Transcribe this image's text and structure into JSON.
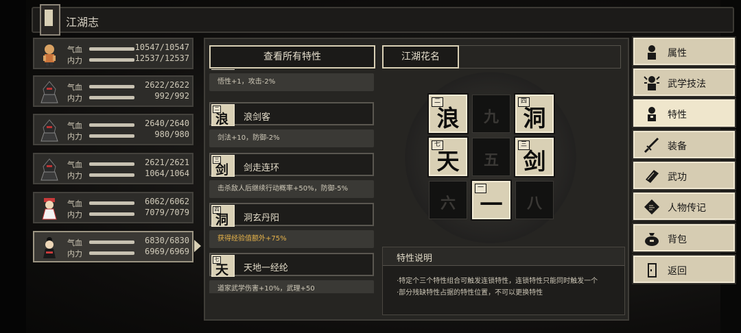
{
  "window": {
    "title": "江湖志"
  },
  "characters": [
    {
      "hp_label": "气血",
      "mp_label": "内力",
      "hp": "10547/10547",
      "mp": "12537/12537"
    },
    {
      "hp_label": "气血",
      "mp_label": "内力",
      "hp": "2622/2622",
      "mp": "992/992"
    },
    {
      "hp_label": "气血",
      "mp_label": "内力",
      "hp": "2640/2640",
      "mp": "980/980"
    },
    {
      "hp_label": "气血",
      "mp_label": "内力",
      "hp": "2621/2621",
      "mp": "1064/1064"
    },
    {
      "hp_label": "气血",
      "mp_label": "内力",
      "hp": "6062/6062",
      "mp": "7079/7079"
    },
    {
      "hp_label": "气血",
      "mp_label": "内力",
      "hp": "6830/6830",
      "mp": "6969/6969"
    }
  ],
  "traits_panel": {
    "view_all_label": "查看所有特性",
    "items": [
      {
        "char": "",
        "num": "",
        "name": "",
        "desc": "悟性+1，攻击-2%"
      },
      {
        "char": "浪",
        "num": "二",
        "name": "浪剑客",
        "desc": "剑法+10，防御-2%"
      },
      {
        "char": "剑",
        "num": "三",
        "name": "剑走连环",
        "desc": "击杀敌人后继续行动概率+50%，防御-5%"
      },
      {
        "char": "洞",
        "num": "四",
        "name": "洞玄丹阳",
        "desc": "获得经验值额外+75%"
      },
      {
        "char": "天",
        "num": "七",
        "name": "天地一经纶",
        "desc": "道家武学伤害+10%，武理+50"
      }
    ]
  },
  "combo": {
    "title_label": "江湖花名",
    "cells": [
      {
        "char": "浪",
        "num": "二",
        "active": true
      },
      {
        "char": "九",
        "num": "",
        "active": false
      },
      {
        "char": "洞",
        "num": "四",
        "active": true
      },
      {
        "char": "天",
        "num": "七",
        "active": true
      },
      {
        "char": "五",
        "num": "",
        "active": false
      },
      {
        "char": "剑",
        "num": "三",
        "active": true
      },
      {
        "char": "六",
        "num": "",
        "active": false
      },
      {
        "char": "一",
        "num": "一",
        "active": true
      },
      {
        "char": "八",
        "num": "",
        "active": false
      }
    ]
  },
  "explanation": {
    "title": "特性说明",
    "lines": [
      "·特定个三个特性组合可触发连锁特性，连锁特性只能同时触发一个",
      "·部分残缺特性占据的特性位置，不可以更换特性"
    ]
  },
  "menu": [
    {
      "label": "属性",
      "icon": "person-icon"
    },
    {
      "label": "武学技法",
      "icon": "martial-skill-icon"
    },
    {
      "label": "特性",
      "icon": "trait-person-icon",
      "active": true
    },
    {
      "label": "装备",
      "icon": "sword-icon"
    },
    {
      "label": "武功",
      "icon": "book-icon"
    },
    {
      "label": "人物传记",
      "icon": "scroll-icon"
    },
    {
      "label": "背包",
      "icon": "bag-icon"
    },
    {
      "label": "返回",
      "icon": "door-icon"
    }
  ],
  "colors": {
    "accent": "#d9d0b5",
    "gold_text": "#e7b34a",
    "panel": "#262522"
  }
}
